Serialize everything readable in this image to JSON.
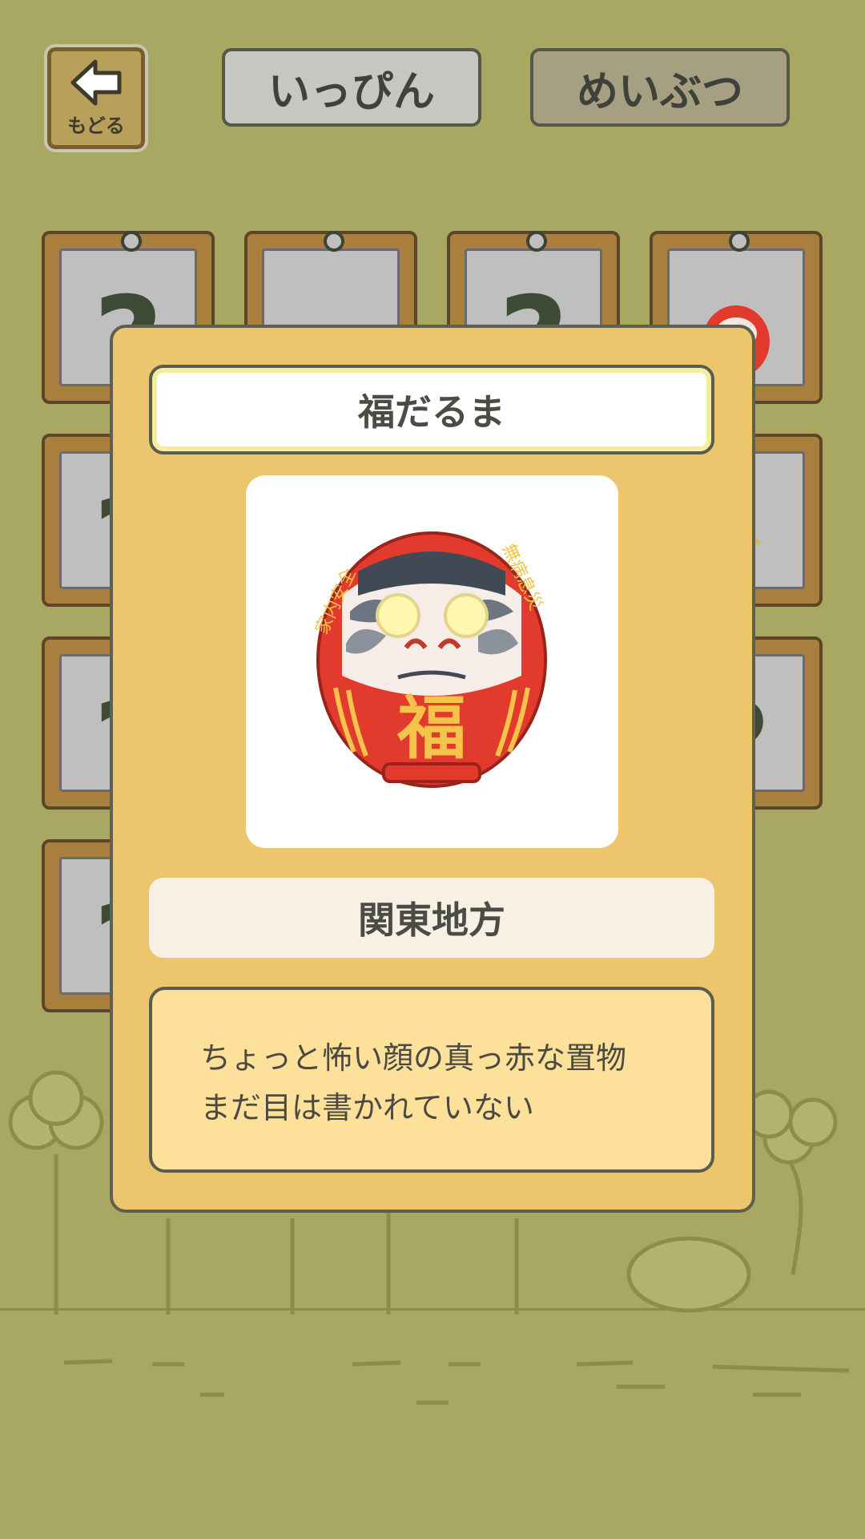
{
  "header": {
    "back_label": "もどる",
    "tabs": [
      {
        "label": "いっぴん",
        "selected": false
      },
      {
        "label": "めいぶつ",
        "selected": true
      }
    ]
  },
  "grid": {
    "cards": [
      {
        "content": "?"
      },
      {
        "content": "item-icon"
      },
      {
        "content": "?"
      },
      {
        "content": "daruma-icon"
      },
      {
        "content": "?"
      },
      {
        "content": "hidden"
      },
      {
        "content": "hidden"
      },
      {
        "content": "item-icon"
      },
      {
        "content": "?"
      },
      {
        "content": "hidden"
      },
      {
        "content": "hidden"
      },
      {
        "content": "?"
      },
      {
        "content": "?"
      }
    ]
  },
  "detail": {
    "name": "福だるま",
    "region": "関東地方",
    "description_line1": "ちょっと怖い顔の真っ赤な置物",
    "description_line2": "まだ目は書かれていない",
    "daruma_text_left": "家内安全",
    "daruma_text_right": "無病息災",
    "daruma_belly": "福"
  },
  "colors": {
    "background": "#a9a862",
    "dialog": "#ecc56d",
    "daruma_red": "#e23a2c",
    "text_dark": "#4c4c46"
  }
}
